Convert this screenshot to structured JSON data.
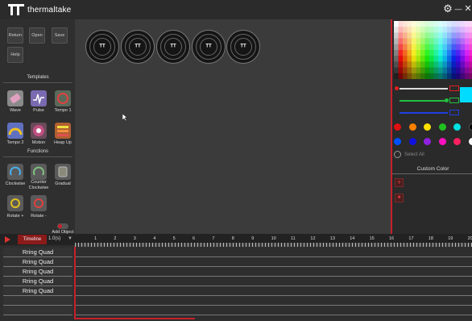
{
  "app": {
    "brand": "thermaltake"
  },
  "window_controls": {
    "settings": "⚙",
    "minimize": "—",
    "close": "✕"
  },
  "toolbar": {
    "return_label": "Return",
    "open_label": "Open",
    "save_label": "Save",
    "help_label": "Help"
  },
  "templates": {
    "title": "Templates",
    "items": [
      {
        "label": "Wave",
        "color": "#8a8a8a"
      },
      {
        "label": "Pulse",
        "color": "#7a6ab0"
      },
      {
        "label": "Tempo 1",
        "color": "#5a6a5a"
      },
      {
        "label": "Tempo 2",
        "color": "#6070c0"
      },
      {
        "label": "Motion",
        "color": "#6a4a5a"
      },
      {
        "label": "Heap Up",
        "color": "#b06030"
      }
    ]
  },
  "functions": {
    "title": "Functions",
    "items": [
      {
        "label": "Clockwise"
      },
      {
        "label": "Counter Clockwise"
      },
      {
        "label": "Gradual"
      },
      {
        "label": "Rotate +"
      },
      {
        "label": "Rotate -"
      }
    ]
  },
  "add_object_label": "Add Object",
  "color_panel": {
    "current_color": "#00dcff",
    "swatches_row1": [
      "#e01010",
      "#ff8000",
      "#ffe000",
      "#20c020",
      "#00e0e0",
      "#000000"
    ],
    "swatches_row2": [
      "#0050ff",
      "#1010e0",
      "#9020e0",
      "#ff10c0",
      "#ff2060",
      "#ffffff"
    ],
    "select_all_label": "Select All",
    "custom_color_title": "Custom Color",
    "add_icon": "+",
    "delete_icon": "■"
  },
  "timeline": {
    "tab_label": "Timeline",
    "speed": "1.0(s)",
    "filter_icon": "▼",
    "ticks": [
      "1",
      "2",
      "3",
      "4",
      "5",
      "6",
      "7",
      "8",
      "9",
      "10",
      "11",
      "12",
      "13",
      "14",
      "15",
      "16",
      "17",
      "18",
      "19",
      "20"
    ],
    "tracks": [
      "Rring Quad",
      "Rring Quad",
      "Rring Quad",
      "Rring Quad",
      "Rring Quad"
    ]
  },
  "fans": {
    "count": 5,
    "logo": "TT"
  }
}
